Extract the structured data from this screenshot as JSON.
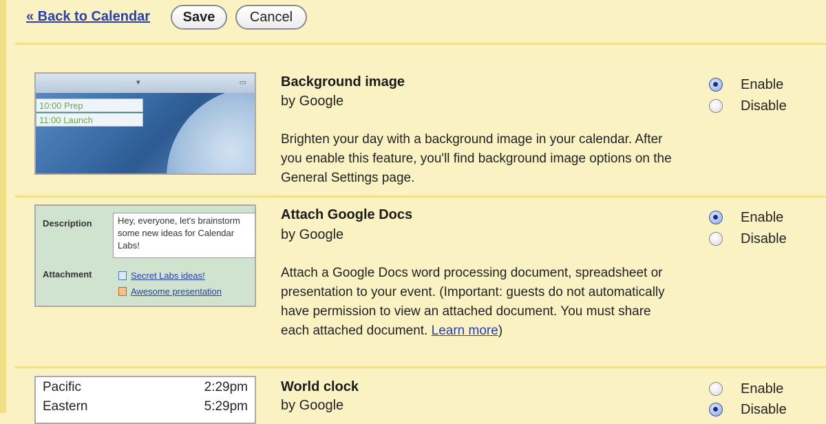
{
  "toolbar": {
    "back_link": "« Back to Calendar",
    "save_label": "Save",
    "cancel_label": "Cancel"
  },
  "labs": [
    {
      "title": "Background image",
      "author": "by Google",
      "description": "Brighten your day with a background image in your calendar. After you enable this feature, you'll find background image options on the General Settings page.",
      "enable_label": "Enable",
      "disable_label": "Disable",
      "selected": "Enable",
      "preview": {
        "events": [
          "10:00 Prep",
          "11:00 Launch"
        ]
      }
    },
    {
      "title": "Attach Google Docs",
      "author": "by Google",
      "description": "Attach a Google Docs word processing document, spreadsheet or presentation to your event. (Important: guests do not automatically have permission to view an attached document. You must share each attached document.",
      "learn_more": "Learn more",
      "desc_suffix": ")",
      "enable_label": "Enable",
      "disable_label": "Disable",
      "selected": "Enable",
      "preview": {
        "description_label": "Description",
        "description_text": "Hey, everyone, let's brainstorm some new ideas for Calendar Labs!",
        "attachment_label": "Attachment",
        "attachments": [
          "Secret Labs ideas!",
          "Awesome presentation"
        ]
      }
    },
    {
      "title": "World clock",
      "author": "by Google",
      "enable_label": "Enable",
      "disable_label": "Disable",
      "selected": "Disable",
      "preview": {
        "clocks": [
          {
            "city": "Pacific",
            "time": "2:29pm"
          },
          {
            "city": "Eastern",
            "time": "5:29pm"
          }
        ]
      }
    }
  ],
  "colors": {
    "page_background": "#fbf2c4",
    "divider": "#f3df86",
    "link": "#2a3fb0"
  }
}
